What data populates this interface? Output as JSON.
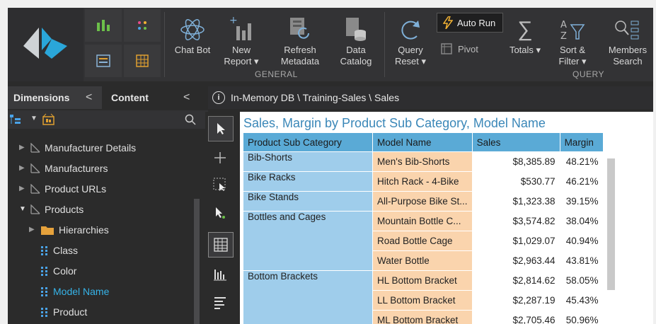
{
  "ribbon": {
    "general_label": "GENERAL",
    "query_label": "QUERY",
    "buttons": {
      "chat_bot": "Chat Bot",
      "new_report": "New\nReport ▾",
      "refresh_metadata": "Refresh\nMetadata",
      "data_catalog": "Data\nCatalog",
      "query_reset": "Query\nReset ▾",
      "auto_run": "Auto Run",
      "pivot": "Pivot",
      "totals": "Totals ▾",
      "sort_filter": "Sort &\nFilter ▾",
      "members_search": "Members\nSearch"
    }
  },
  "left_panel": {
    "tab_dimensions": "Dimensions",
    "tab_content": "Content",
    "chev": "<",
    "tree": [
      {
        "label": "Manufacturer Details",
        "expanded": false
      },
      {
        "label": "Manufacturers",
        "expanded": false
      },
      {
        "label": "Product URLs",
        "expanded": false
      },
      {
        "label": "Products",
        "expanded": true
      },
      {
        "label": "Hierarchies",
        "expanded": false
      },
      {
        "label": "Class"
      },
      {
        "label": "Color"
      },
      {
        "label": "Model Name",
        "selected": true
      },
      {
        "label": "Product"
      }
    ]
  },
  "breadcrumb": {
    "info": "i",
    "path": "In-Memory DB \\ Training-Sales \\ Sales"
  },
  "report": {
    "title": "Sales, Margin by Product Sub Category, Model Name",
    "headers": [
      "Product Sub Category",
      "Model Name",
      "Sales",
      "Margin"
    ],
    "rows": [
      {
        "cat": "Bib-Shorts",
        "model": "Men's Bib-Shorts",
        "sales": "$8,385.89",
        "margin": "48.21%"
      },
      {
        "cat": "Bike Racks",
        "model": "Hitch Rack - 4-Bike",
        "sales": "$530.77",
        "margin": "46.21%"
      },
      {
        "cat": "Bike Stands",
        "model": "All-Purpose Bike St...",
        "sales": "$1,323.38",
        "margin": "39.15%"
      },
      {
        "cat": "Bottles and Cages",
        "model": "Mountain Bottle C...",
        "sales": "$3,574.82",
        "margin": "38.04%"
      },
      {
        "cat": "",
        "model": "Road Bottle Cage",
        "sales": "$1,029.07",
        "margin": "40.94%"
      },
      {
        "cat": "",
        "model": "Water Bottle",
        "sales": "$2,963.44",
        "margin": "43.81%"
      },
      {
        "cat": "Bottom Brackets",
        "model": "HL Bottom Bracket",
        "sales": "$2,814.62",
        "margin": "58.05%"
      },
      {
        "cat": "",
        "model": "LL Bottom Bracket",
        "sales": "$2,287.19",
        "margin": "45.43%"
      },
      {
        "cat": "",
        "model": "ML Bottom Bracket",
        "sales": "$2,705.46",
        "margin": "50.96%"
      }
    ]
  },
  "colors": {
    "accent": "#36b3e8",
    "header_blue": "#5aaad6",
    "cat_blue": "#9fcdeb",
    "model_orange": "#fad4ad",
    "title_blue": "#3a87b8"
  }
}
